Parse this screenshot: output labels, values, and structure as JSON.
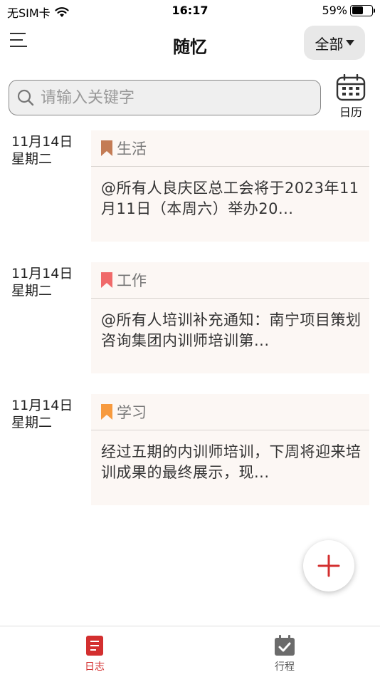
{
  "status_bar": {
    "carrier": "无SIM卡",
    "time": "16:17",
    "battery_percent": "59%",
    "battery_level": 0.59
  },
  "nav": {
    "title": "随忆",
    "filter_label": "全部"
  },
  "search": {
    "placeholder": "请输入关键字",
    "value": ""
  },
  "calendar": {
    "label": "日历"
  },
  "entries": [
    {
      "date": "11月14日",
      "weekday": "星期二",
      "tag": "生活",
      "tag_color": "#c47c55",
      "text": "@所有人良庆区总工会将于2023年11月11日（本周六）举办20..."
    },
    {
      "date": "11月14日",
      "weekday": "星期二",
      "tag": "工作",
      "tag_color": "#f06a6a",
      "text": "@所有人培训补充通知：南宁项目策划咨询集团内训师培训第..."
    },
    {
      "date": "11月14日",
      "weekday": "星期二",
      "tag": "学习",
      "tag_color": "#f79a3e",
      "text": "经过五期的内训师培训，下周将迎来培训成果的最终展示，现..."
    }
  ],
  "fab": {
    "icon": "plus-icon",
    "color": "#d32f2f"
  },
  "tabs": [
    {
      "label": "日志",
      "icon": "journal-icon",
      "active": true,
      "color": "#d32f2f"
    },
    {
      "label": "行程",
      "icon": "schedule-icon",
      "active": false,
      "color": "#666666"
    }
  ]
}
